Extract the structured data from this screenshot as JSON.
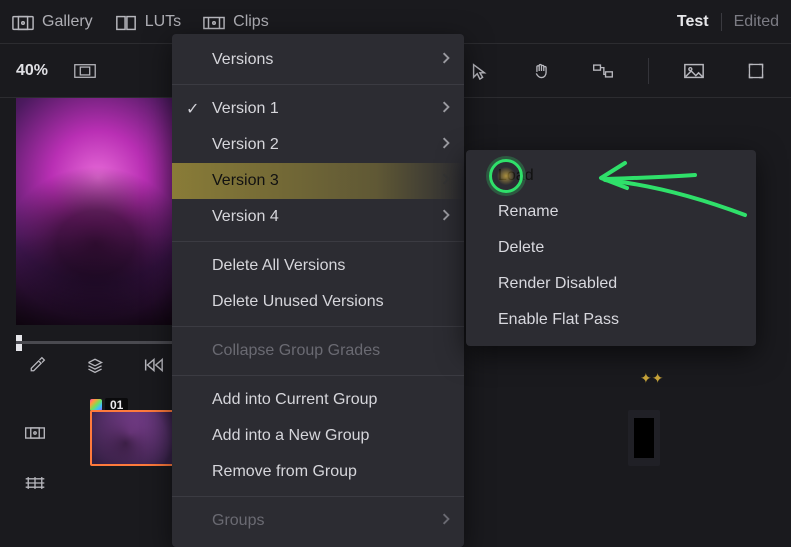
{
  "project": {
    "title": "Test",
    "status": "Edited"
  },
  "topnav": {
    "gallery": "Gallery",
    "luts": "LUTs",
    "clips": "Clips"
  },
  "toolbar": {
    "zoom": "40%"
  },
  "thumb": {
    "index": "01"
  },
  "menu": {
    "versions": "Versions",
    "version1": "Version 1",
    "version2": "Version 2",
    "version3": "Version 3",
    "version4": "Version 4",
    "delete_all": "Delete All Versions",
    "delete_unused": "Delete Unused Versions",
    "collapse_group": "Collapse Group Grades",
    "add_current": "Add into Current Group",
    "add_new": "Add into a New Group",
    "remove_group": "Remove from Group",
    "groups": "Groups"
  },
  "submenu": {
    "load": "Load",
    "rename": "Rename",
    "delete": "Delete",
    "render_disabled": "Render Disabled",
    "enable_flat": "Enable Flat Pass"
  }
}
